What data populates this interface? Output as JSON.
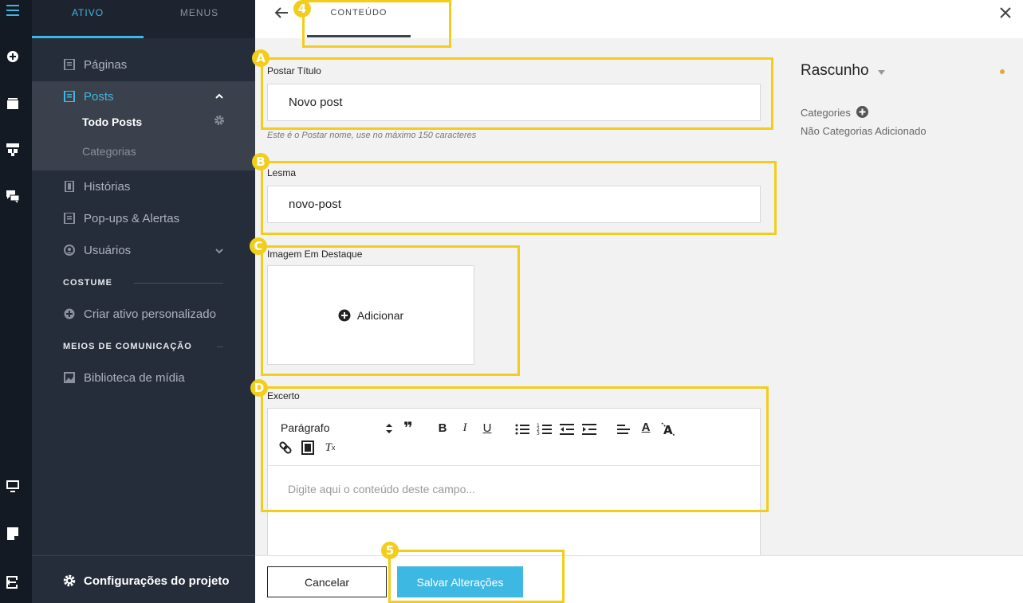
{
  "sidebar": {
    "tabs": [
      "ATIVO",
      "MENUS"
    ],
    "items": {
      "paginas": "Páginas",
      "posts": "Posts",
      "todo_posts": "Todo Posts",
      "categorias": "Categorias",
      "historias": "Histórias",
      "popups": "Pop-ups & Alertas",
      "usuarios": "Usuários"
    },
    "section_custom": "COSTUME",
    "create_custom": "Criar ativo personalizado",
    "section_media": "MEIOS DE COMUNICAÇÃO",
    "media_library": "Biblioteca de mídia",
    "settings": "Configurações do projeto"
  },
  "topbar": {
    "content_tab": "CONTEÚDO"
  },
  "form": {
    "title_label": "Postar Título",
    "title_value": "Novo post",
    "title_hint": "Este é o Postar nome, use no máximo 150 caracteres",
    "slug_label": "Lesma",
    "slug_value": "novo-post",
    "image_label": "Imagem Em Destaque",
    "image_add": "Adicionar",
    "excerpt_label": "Excerto",
    "excerpt_format": "Parágrafo",
    "excerpt_placeholder": "Digite aqui o conteúdo deste campo..."
  },
  "right_panel": {
    "status": "Rascunho",
    "categories_label": "Categories",
    "categories_empty": "Não Categorias Adicionado"
  },
  "buttons": {
    "cancel": "Cancelar",
    "save": "Salvar Alterações"
  },
  "callouts": {
    "a": "A",
    "b": "B",
    "c": "C",
    "d": "D",
    "n4": "4",
    "n5": "5"
  },
  "colors": {
    "accent": "#3db8e2",
    "callout": "#f2cd1b",
    "status_dot": "#e3a93a",
    "sidebar_bg": "#252d3a"
  }
}
